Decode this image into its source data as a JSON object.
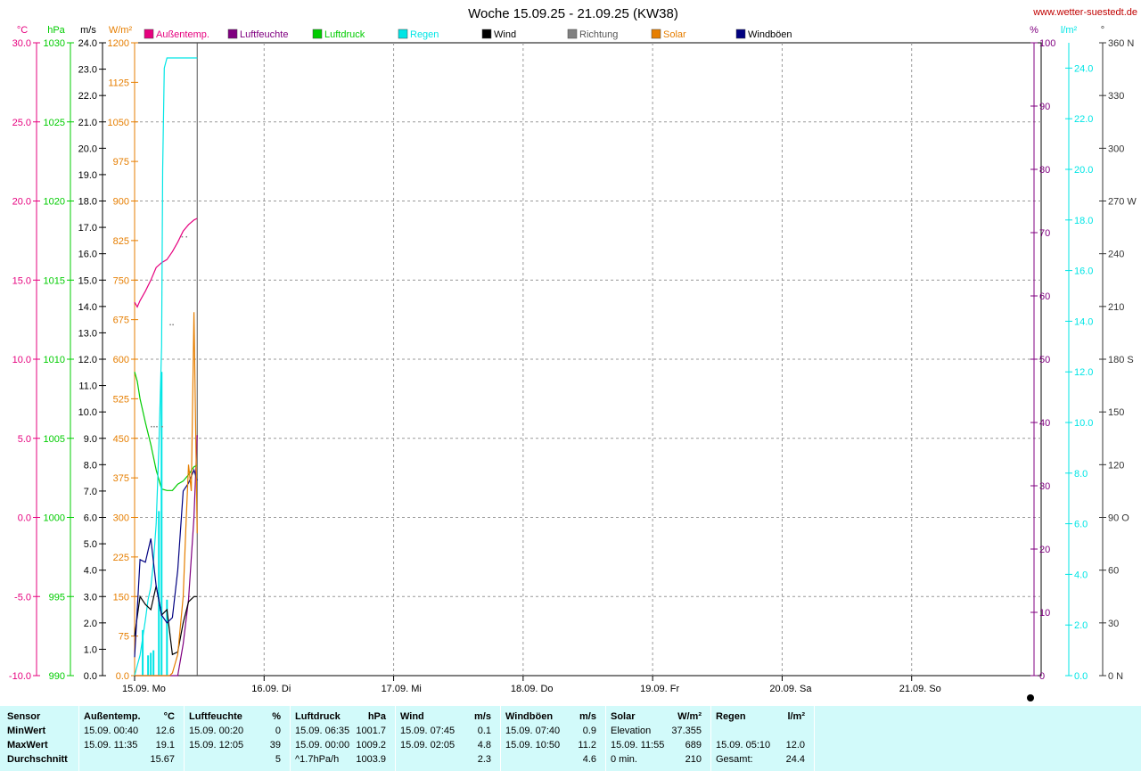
{
  "title": "Woche 15.09.25 - 21.09.25 (KW38)",
  "site": "www.wetter-suestedt.de",
  "colors": {
    "temp": "#e6007e",
    "hum": "#800080",
    "press": "#00cc00",
    "rain": "#00e5e5",
    "wind": "#000000",
    "dir": "#808080",
    "solar": "#e67e00",
    "gust": "#000080"
  },
  "chart_data": {
    "type": "line",
    "title": "Woche 15.09.25 - 21.09.25 (KW38)",
    "x_axis_days": [
      "15.09.  Mo",
      "16.09.  Di",
      "17.09.  Mi",
      "18.09.  Do",
      "19.09.  Fr",
      "20.09.  Sa",
      "21.09.  So"
    ],
    "x_unit": "hours since 15.09. 00:00",
    "legend": [
      "Außentemp.",
      "Luftfeuchte",
      "Luftdruck",
      "Regen",
      "Wind",
      "Richtung",
      "Solar",
      "Windböen"
    ],
    "axes": {
      "temp": {
        "unit": "°C",
        "range": [
          -10,
          30
        ],
        "ticks": [
          "30.0",
          "25.0",
          "20.0",
          "15.0",
          "10.0",
          "5.0",
          "0.0",
          "-5.0",
          "-10.0"
        ]
      },
      "press": {
        "unit": "hPa",
        "range": [
          990,
          1030
        ],
        "ticks": [
          "1030",
          "1025",
          "1020",
          "1015",
          "1010",
          "1005",
          "1000",
          "995",
          "990"
        ]
      },
      "wind": {
        "unit": "m/s",
        "range": [
          0,
          24
        ],
        "ticks": [
          "24.0",
          "23.0",
          "22.0",
          "21.0",
          "20.0",
          "19.0",
          "18.0",
          "17.0",
          "16.0",
          "15.0",
          "14.0",
          "13.0",
          "12.0",
          "11.0",
          "10.0",
          "9.0",
          "8.0",
          "7.0",
          "6.0",
          "5.0",
          "4.0",
          "3.0",
          "2.0",
          "1.0",
          "0.0"
        ]
      },
      "solar": {
        "unit": "W/m²",
        "range": [
          0,
          1200
        ],
        "ticks": [
          "1200",
          "1125",
          "1050",
          "975",
          "900",
          "825",
          "750",
          "675",
          "600",
          "525",
          "450",
          "375",
          "300",
          "225",
          "150",
          "75",
          "0.0"
        ]
      },
      "hum": {
        "unit": "%",
        "range": [
          0,
          100
        ],
        "ticks": [
          "100",
          "90",
          "80",
          "70",
          "60",
          "50",
          "40",
          "30",
          "20",
          "10",
          "0"
        ]
      },
      "rain": {
        "unit": "l/m²",
        "range": [
          0,
          25
        ],
        "ticks": [
          "24.0",
          "22.0",
          "20.0",
          "18.0",
          "16.0",
          "14.0",
          "12.0",
          "10.0",
          "8.0",
          "6.0",
          "4.0",
          "2.0",
          "0.0"
        ]
      },
      "dir": {
        "unit": "°",
        "range": [
          0,
          360
        ],
        "ticks": [
          "360 N",
          "330",
          "300",
          "270 W",
          "240",
          "210",
          "180 S",
          "150",
          "120",
          "90  O",
          "60",
          "30",
          "0  N"
        ]
      }
    },
    "series": [
      {
        "name": "Außentemp.",
        "axis": "temp",
        "x": [
          0,
          0.5,
          1,
          2,
          3,
          4,
          5,
          6,
          7,
          8,
          9,
          10,
          11,
          11.6
        ],
        "y": [
          13.6,
          13.3,
          13.7,
          14.3,
          15.0,
          15.8,
          16.1,
          16.3,
          16.8,
          17.4,
          18.1,
          18.5,
          18.8,
          18.9
        ]
      },
      {
        "name": "Luftfeuchte",
        "axis": "hum",
        "x": [
          0,
          1,
          2,
          3,
          4,
          5,
          6,
          7,
          8,
          9,
          10,
          11,
          11.6
        ],
        "y": [
          0,
          0,
          0,
          0,
          0,
          0,
          0,
          0,
          0,
          5,
          12,
          25,
          38
        ]
      },
      {
        "name": "Luftdruck",
        "axis": "press",
        "x": [
          0,
          0.5,
          1,
          2,
          3,
          4,
          5,
          6,
          7,
          8,
          9,
          10,
          11,
          11.6
        ],
        "y": [
          1009.2,
          1008.6,
          1007.5,
          1006.0,
          1004.6,
          1003.0,
          1001.8,
          1001.7,
          1001.7,
          1002.1,
          1002.3,
          1002.7,
          1003.2,
          1003.3
        ]
      },
      {
        "name": "Regen",
        "axis": "rain",
        "x": [
          0,
          0.5,
          1,
          1.5,
          2,
          2.5,
          3,
          3.5,
          4,
          4.5,
          5,
          5.2,
          5.5,
          6,
          7,
          8,
          9,
          10,
          11,
          11.6
        ],
        "y": [
          0,
          0.4,
          0.8,
          1.5,
          2.2,
          3.0,
          3.5,
          4.5,
          6.0,
          9.0,
          13.0,
          20.0,
          24.0,
          24.4,
          24.4,
          24.4,
          24.4,
          24.4,
          24.4,
          24.4
        ]
      },
      {
        "name": "Regen Intensität",
        "axis": "rain",
        "bars": true,
        "x": [
          1.5,
          2.5,
          3.0,
          3.5,
          4.5,
          5.0,
          6.0
        ],
        "y": [
          1.8,
          0.8,
          0.9,
          1.0,
          6.5,
          12.0,
          3.0
        ]
      },
      {
        "name": "Wind",
        "axis": "wind",
        "x": [
          0,
          1,
          2,
          3,
          4,
          5,
          6,
          7,
          8,
          9,
          10,
          11,
          11.6
        ],
        "y": [
          1.5,
          3.0,
          2.7,
          2.5,
          3.4,
          2.3,
          2.5,
          0.8,
          0.9,
          2.0,
          2.8,
          3.0,
          3.0
        ]
      },
      {
        "name": "Windböen",
        "axis": "wind",
        "x": [
          0,
          1,
          2,
          3,
          4,
          5,
          6,
          7,
          8,
          9,
          10,
          11,
          11.6
        ],
        "y": [
          0.7,
          4.4,
          4.3,
          5.2,
          3.4,
          2.3,
          2.0,
          2.2,
          4.0,
          7.0,
          7.3,
          7.8,
          7.4
        ]
      },
      {
        "name": "Solar",
        "axis": "solar",
        "x": [
          0,
          5,
          6,
          6.5,
          7,
          8,
          9,
          9.5,
          10,
          10.5,
          11,
          11.6
        ],
        "y": [
          0,
          0,
          0,
          0,
          5,
          40,
          150,
          280,
          400,
          350,
          689,
          270
        ]
      },
      {
        "name": "Richtung",
        "axis": "dir",
        "points": true,
        "x": [
          3,
          3.5,
          4,
          5,
          6.5,
          7,
          8.7,
          9.5
        ],
        "y": [
          142,
          142,
          142,
          142,
          200,
          200,
          250,
          250
        ]
      }
    ]
  },
  "stats": {
    "row_labels": [
      "Sensor",
      "MinWert",
      "MaxWert",
      "Durchschnitt"
    ],
    "blocks": [
      {
        "name": "Außentemp.",
        "unit": "°C",
        "min_t": "15.09.  00:40",
        "min_v": "12.6",
        "max_t": "15.09.  11:35",
        "max_v": "19.1",
        "avg_t": "",
        "avg_v": "15.67"
      },
      {
        "name": "Luftfeuchte",
        "unit": "%",
        "min_t": "15.09.  00:20",
        "min_v": "0",
        "max_t": "15.09.  12:05",
        "max_v": "39",
        "avg_t": "",
        "avg_v": "5"
      },
      {
        "name": "Luftdruck",
        "unit": "hPa",
        "min_t": "15.09.  06:35",
        "min_v": "1001.7",
        "max_t": "15.09.  00:00",
        "max_v": "1009.2",
        "avg_t": "^1.7hPa/h",
        "avg_v": "1003.9"
      },
      {
        "name": "Wind",
        "unit": "m/s",
        "min_t": "15.09.  07:45",
        "min_v": "0.1",
        "max_t": "15.09.  02:05",
        "max_v": "4.8",
        "avg_t": "",
        "avg_v": "2.3"
      },
      {
        "name": "Windböen",
        "unit": "m/s",
        "min_t": "15.09.  07:40",
        "min_v": "0.9",
        "max_t": "15.09.  10:50",
        "max_v": "11.2",
        "avg_t": "",
        "avg_v": "4.6"
      },
      {
        "name": "Solar",
        "unit": "W/m²",
        "min_t": "Elevation",
        "min_v": "37.355",
        "max_t": "15.09.  11:55",
        "max_v": "689",
        "avg_t": "0 min.",
        "avg_v": "210"
      },
      {
        "name": "Regen",
        "unit": "l/m²",
        "min_t": "",
        "min_v": "",
        "max_t": "15.09.  05:10",
        "max_v": "12.0",
        "avg_t": "Gesamt:",
        "avg_v": "24.4"
      }
    ]
  }
}
